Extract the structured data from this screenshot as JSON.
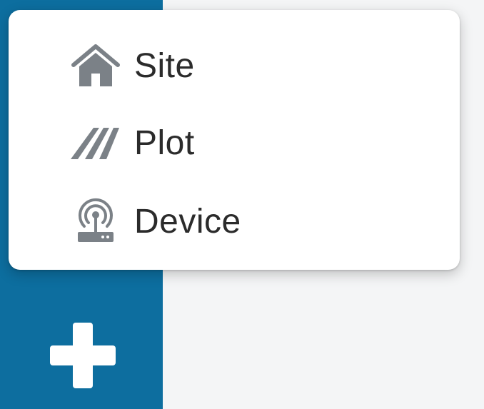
{
  "menu": {
    "items": [
      {
        "label": "Site",
        "icon": "home-icon"
      },
      {
        "label": "Plot",
        "icon": "plot-icon"
      },
      {
        "label": "Device",
        "icon": "device-icon"
      }
    ]
  },
  "add_button": {
    "icon": "plus-icon"
  },
  "colors": {
    "accent": "#0d6e9f",
    "icon": "#7b8187",
    "text": "#2b2b2b"
  }
}
